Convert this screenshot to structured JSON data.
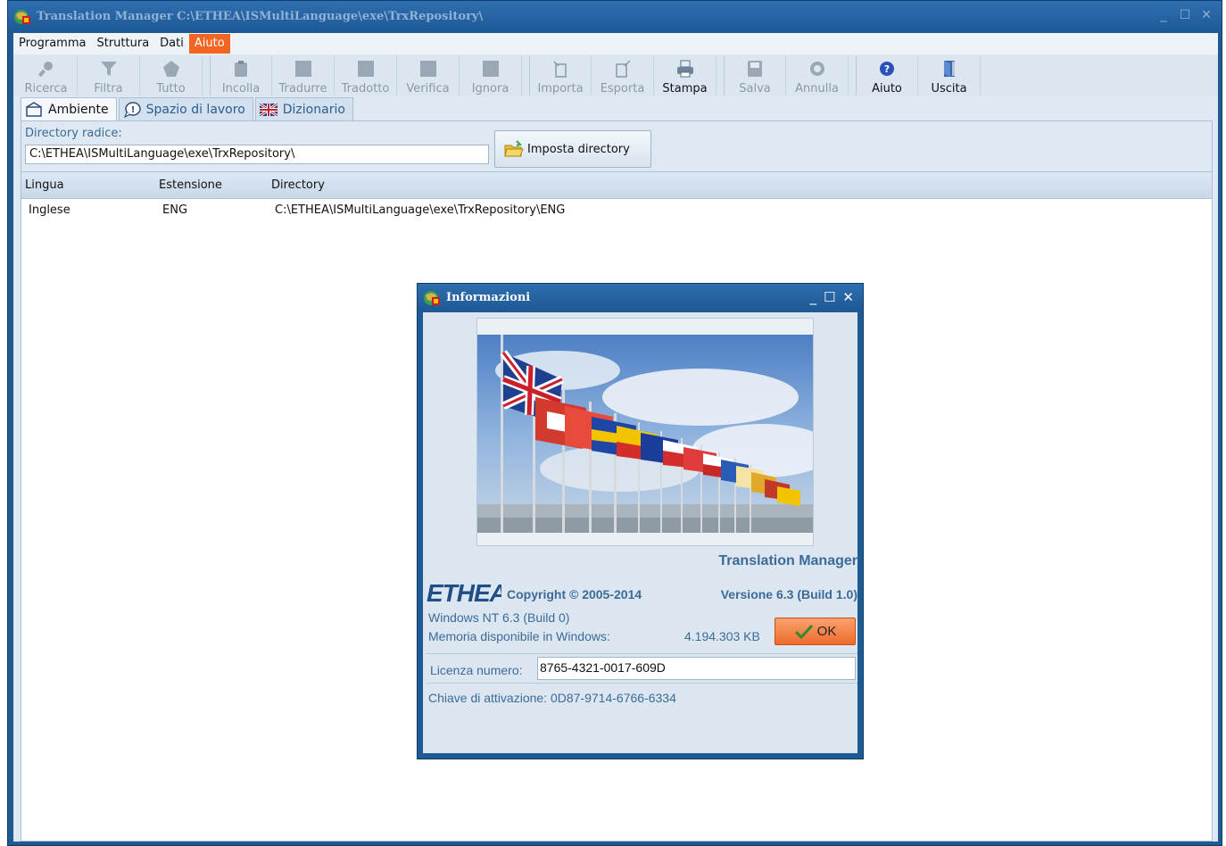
{
  "window": {
    "title": "Translation Manager C:\\ETHEA\\ISMultiLanguage\\exe\\TrxRepository\\",
    "controls": [
      "_",
      "☐",
      "✕"
    ]
  },
  "menu": [
    "Programma",
    "Struttura",
    "Dati",
    "Aiuto"
  ],
  "toolbar": [
    {
      "label": "Ricerca",
      "icon": "search-icon"
    },
    {
      "label": "Filtra",
      "icon": "filter-icon"
    },
    {
      "label": "Tutto",
      "icon": "all-icon"
    },
    {
      "label": "Incolla",
      "icon": "paste-icon"
    },
    {
      "label": "Tradurre",
      "icon": "translate-icon"
    },
    {
      "label": "Tradotto",
      "icon": "translated-icon"
    },
    {
      "label": "Verifica",
      "icon": "verify-icon"
    },
    {
      "label": "Ignora",
      "icon": "ignore-icon"
    },
    {
      "label": "Importa",
      "icon": "import-icon"
    },
    {
      "label": "Esporta",
      "icon": "export-icon"
    },
    {
      "label": "Stampa",
      "icon": "print-icon"
    },
    {
      "label": "Salva",
      "icon": "save-icon"
    },
    {
      "label": "Annulla",
      "icon": "cancel-icon"
    },
    {
      "label": "Aiuto",
      "icon": "help-icon"
    },
    {
      "label": "Uscita",
      "icon": "exit-icon"
    }
  ],
  "tabs": [
    {
      "label": "Ambiente",
      "icon": "environment-icon"
    },
    {
      "label": "Spazio di lavoro",
      "icon": "workspace-icon"
    },
    {
      "label": "Dizionario",
      "icon": "uk-flag-icon"
    }
  ],
  "env": {
    "dir_label": "Directory radice:",
    "dir_value": "C:\\ETHEA\\ISMultiLanguage\\exe\\TrxRepository\\",
    "set_dir_button": "Imposta directory"
  },
  "grid": {
    "headers": [
      "Lingua",
      "Estensione",
      "Directory"
    ],
    "rows": [
      [
        "Inglese",
        "ENG",
        "C:\\ETHEA\\ISMultiLanguage\\exe\\TrxRepository\\ENG"
      ]
    ]
  },
  "dialog": {
    "title": "Informazioni",
    "controls": [
      "_",
      "☐",
      "✕"
    ],
    "product": "Translation Manager",
    "logo_text": "ETHEA",
    "copyright": "Copyright © 2005-2014",
    "version": "Versione 6.3 (Build 1.0)",
    "os": "Windows NT 6.3 (Build 0)",
    "memory_label": "Memoria disponibile in Windows:",
    "memory_value": "4.194.303 KB",
    "ok_button": "OK",
    "license_label": "Licenza numero:",
    "license_value": "8765-4321-0017-609D",
    "activation_key": "Chiave di attivazione: 0D87-9714-6766-6334"
  },
  "colors": {
    "accent": "#f26522",
    "title_bar": "#1f5a92",
    "text_blue": "#3d6b97"
  }
}
